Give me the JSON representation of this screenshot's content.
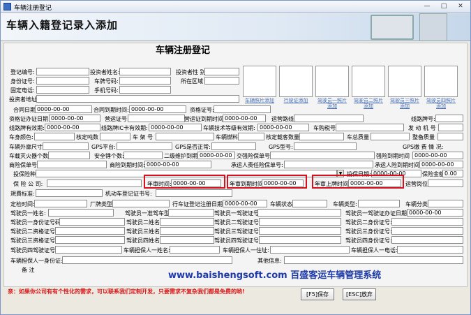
{
  "window": {
    "title": "车辆注册登记"
  },
  "banner": {
    "title": "车辆入籍登记录入添加"
  },
  "form": {
    "title": "车辆注册登记",
    "fields": {
      "reg_no": "登记编号:",
      "investor_name": "投资者姓名:",
      "investor_gender": "投资者性 别",
      "id_no": "身份证号:",
      "plate_no": "车牌号码:",
      "district": "所在区域",
      "landline": "固定电话:",
      "mobile": "手机号码:",
      "investor_addr": "投资者地址:",
      "contract_date": "合同日期",
      "contract_date_val": "0000-00-00",
      "contract_expire": "合同到期时间:",
      "contract_expire_val": "0000-00-00",
      "qual_cert": "资格证号:",
      "qual_issue": "资格证办证日期:",
      "qual_issue_val": "0000-00-00",
      "op_cert": "营运证号:",
      "op_expire": "营运证到期时间:",
      "op_expire_val": "0000-00-00",
      "op_route": "运营路线:",
      "route_plate": "线路牌号:",
      "route_valid": "线路牌有效期:",
      "route_valid_val": "0000-00-00",
      "route_card_valid": "线路牌IC卡有效期:",
      "route_card_valid_val": "0000-00-00",
      "tech_grade_valid": "车辆技术等级有效期:",
      "tech_grade_valid_val": "0000-00-00",
      "tax_no": "车购税号",
      "engine_no": "发 动 机 号",
      "color": "车身颜色:",
      "tonnage": "核定吨数",
      "frame_no": "车 架 号",
      "fuel": "车辆燃料",
      "seats": "核定载客数量",
      "gross_mass": "车总质量",
      "curb_mass": "整备质量",
      "dimensions": "车辆外廓尺寸:",
      "gps_platform": "GPS平台:",
      "gps_normal": "GPS是否正常:",
      "gps_model": "GPS型号:",
      "gps_status": "GPS缴 费 情 况:",
      "extinguishers": "车载灭火器个数:",
      "belts": "安全锤个数:",
      "maint_expire": "二级维护到期时间",
      "maint_expire_val": "0000-00-00",
      "comp_policy": "交强险保单号:",
      "comp_expire": "强险到期时间",
      "comp_expire_val": "0000-00-00",
      "biz_policy": "商险保单号",
      "biz_expire": "商险到期时间:",
      "biz_expire_val": "0000-00-00",
      "carrier_policy": "承运人责任险保单号:",
      "carrier_expire": "承运人险到期时间:",
      "carrier_expire_val": "0000-00-00",
      "ins_type": "投保险种",
      "ins_date": "投保日期:",
      "ins_date_val": "0000-00-00",
      "ins_amount": "保险金额",
      "ins_amount_val": "0.00",
      "insurer": "保 险 公 司:",
      "annual_check": "年审时间:",
      "annual_check_val": "0000-00-00",
      "annual_due": "年审到期时间:",
      "annual_due_val": "0000-00-00",
      "annual_plate": "年审上牌时间:",
      "annual_plate_val": "0000-00-00",
      "op_post": "运营岗位",
      "scale_std": "規費标准:",
      "motor_reg": "机动车登记证书号:",
      "fixed_time": "定检时间:",
      "maker": "厂牌类型",
      "reg_date": "行车证登记注册日期:",
      "reg_date_val": "0000-00-00",
      "vehicle_state": "车辆状态",
      "vehicle_type": "车辆类型:",
      "vehicle_class": "车辆分类",
      "d1_name": "驾驶员一姓名:",
      "d1_type": "驾驶员一准驾车型:",
      "d1_lic": "驾驶员一驾驶证号:",
      "d1_lic_date": "驾驶员一驾驶证办证日期:",
      "d1_lic_date_val": "0000-00-00",
      "d1_id": "驾驶员一身份证号码:",
      "d2_name": "驾驶员二姓名:",
      "d2_lic": "驾驶员二驾驶证号:",
      "d2_id": "驾驶员二身份证号:",
      "d2_qual": "驾驶员二资格证号:",
      "d3_name": "驾驶员三姓名:",
      "d3_lic": "驾驶员三驾驶证号:",
      "d3_id": "驾驶员三身份证号:",
      "d3_qual": "驾驶员三资格证号:",
      "d4_name": "驾驶员四姓名:",
      "d4_lic": "驾驶员四驾驶证号:",
      "d4_id": "驾驶员四身份证号:",
      "d4_qual": "驾驶员四驾驶证号:",
      "g1_name": "车辆担保人一姓名:",
      "g1_addr": "车辆担保人一住址:",
      "g1_phone": "车辆担保人一电话:",
      "g1_id": "车辆担保人一身份证:",
      "other": "其他信息:",
      "remark": "备    注"
    },
    "photos": [
      {
        "label": "车辆照片添加"
      },
      {
        "label": "行驶证添加"
      },
      {
        "label": "驾驶员一照片添加"
      },
      {
        "label": "驾驶员二照片添加"
      },
      {
        "label": "驾驶员三照片添加"
      },
      {
        "label": "驾驶员四照片添加"
      }
    ]
  },
  "footer": {
    "website": "www.baishengsoft.com  百盛客运车辆管理系统",
    "note": "亲：如果你公司有有个性化的需求，可以联系我们定制开发，只要需求不复杂我们都是免费的哟!",
    "save": "[F5]保存",
    "cancel": "[ESC]放弃"
  },
  "colors": {
    "highlight": "#d8101e",
    "link": "#1d3aa8"
  }
}
